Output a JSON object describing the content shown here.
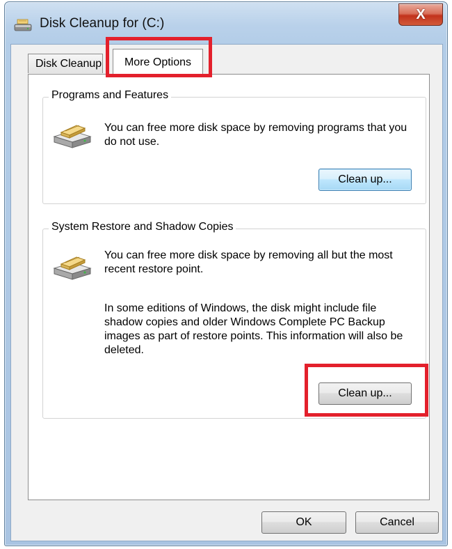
{
  "window": {
    "title": "Disk Cleanup for  (C:)",
    "close_symbol": "X"
  },
  "tabs": [
    {
      "label": "Disk Cleanup",
      "active": false
    },
    {
      "label": "More Options",
      "active": true
    }
  ],
  "groups": {
    "programs": {
      "legend": "Programs and Features",
      "description": "You can free more disk space by removing programs that you do not use.",
      "button_label": "Clean up...",
      "icon": "programs-disk-icon"
    },
    "restore": {
      "legend": "System Restore and Shadow Copies",
      "description": "You can free more disk space by removing all but the most recent restore point.",
      "note": "In some editions of Windows, the disk might include file shadow copies and older Windows Complete PC Backup images as part of restore points. This information will also be deleted.",
      "button_label": "Clean up...",
      "icon": "restore-disk-icon"
    }
  },
  "footer": {
    "ok_label": "OK",
    "cancel_label": "Cancel"
  },
  "colors": {
    "highlight": "#e3202c",
    "window_frame": "#b9d1ea",
    "close_button": "#c2321c"
  }
}
